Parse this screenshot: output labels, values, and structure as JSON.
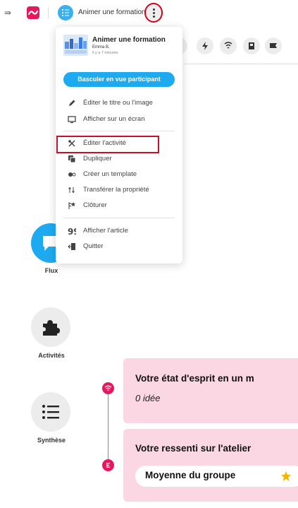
{
  "topbar": {
    "activity_title": "Animer une formation"
  },
  "menu": {
    "header": {
      "title": "Animer une formation",
      "author": "Emma B.",
      "time": "il y a 7 minutes"
    },
    "switch_button": "Basculer en vue participant",
    "items": [
      {
        "label": "Éditer le titre ou l'image",
        "icon": "pencil-icon"
      },
      {
        "label": "Afficher sur un écran",
        "icon": "screen-icon"
      },
      {
        "label": "Éditer l'activité",
        "icon": "tools-icon"
      },
      {
        "label": "Dupliquer",
        "icon": "duplicate-icon"
      },
      {
        "label": "Créer un template",
        "icon": "template-icon"
      },
      {
        "label": "Transférer la propriété",
        "icon": "transfer-icon"
      },
      {
        "label": "Clôturer",
        "icon": "close-activity-icon"
      },
      {
        "label": "Afficher l'article",
        "icon": "quote-icon"
      },
      {
        "label": "Quitter",
        "icon": "exit-icon"
      }
    ]
  },
  "nav": {
    "flux": "Flux",
    "activites": "Activités",
    "synthese": "Synthèse"
  },
  "feed": {
    "card1": {
      "title": "Votre état d'esprit en un m",
      "subtitle": "0 idée"
    },
    "card2": {
      "title": "Votre ressenti sur l'atelier",
      "pill": "Moyenne du groupe"
    }
  },
  "colors": {
    "brand": "#e8175d",
    "accent": "#1eaaf1",
    "card_bg": "#fad7e3",
    "highlight": "#c8102e"
  }
}
